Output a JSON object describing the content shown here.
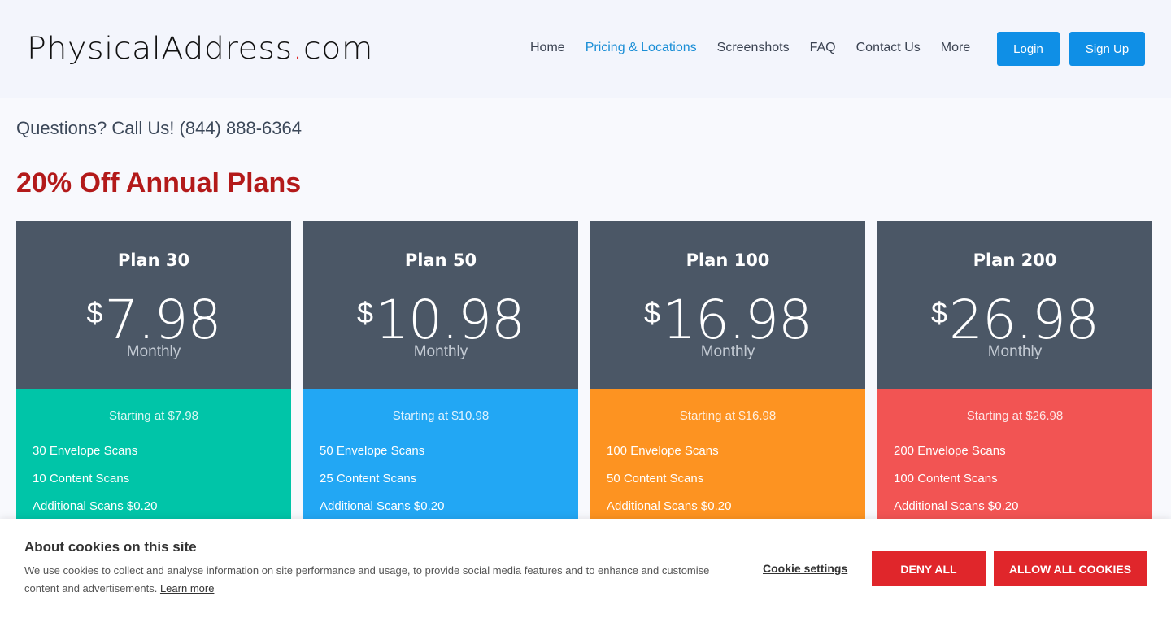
{
  "header": {
    "logo_main": "PhysicalAddress",
    "logo_dot": ".",
    "logo_tld": "com",
    "nav": [
      "Home",
      "Pricing & Locations",
      "Screenshots",
      "FAQ",
      "Contact Us",
      "More"
    ],
    "login": "Login",
    "signup": "Sign Up"
  },
  "questions": "Questions? Call Us! (844) 888-6364",
  "promo": "20% Off Annual Plans",
  "plans": [
    {
      "name": "Plan 30",
      "currency": "$",
      "price": "7.98",
      "period": "Monthly",
      "starting": "Starting at $7.98",
      "color": "#00c5a8",
      "features": [
        "30 Envelope Scans",
        "10 Content Scans",
        "Additional Scans $0.20"
      ]
    },
    {
      "name": "Plan 50",
      "currency": "$",
      "price": "10.98",
      "period": "Monthly",
      "starting": "Starting at $10.98",
      "color": "#22a7f4",
      "features": [
        "50 Envelope Scans",
        "25 Content Scans",
        "Additional Scans $0.20"
      ]
    },
    {
      "name": "Plan 100",
      "currency": "$",
      "price": "16.98",
      "period": "Monthly",
      "starting": "Starting at $16.98",
      "color": "#fd9321",
      "features": [
        "100 Envelope Scans",
        "50 Content Scans",
        "Additional Scans $0.20"
      ]
    },
    {
      "name": "Plan 200",
      "currency": "$",
      "price": "26.98",
      "period": "Monthly",
      "starting": "Starting at $26.98",
      "color": "#f25453",
      "features": [
        "200 Envelope Scans",
        "100 Content Scans",
        "Additional Scans $0.20"
      ]
    }
  ],
  "cookie": {
    "title": "About cookies on this site",
    "text": "We use cookies to collect and analyse information on site performance and usage, to provide social media features and to enhance and customise content and advertisements.",
    "learn_more": "Learn more",
    "settings": "Cookie settings",
    "deny": "DENY ALL",
    "allow": "ALLOW ALL COOKIES"
  }
}
